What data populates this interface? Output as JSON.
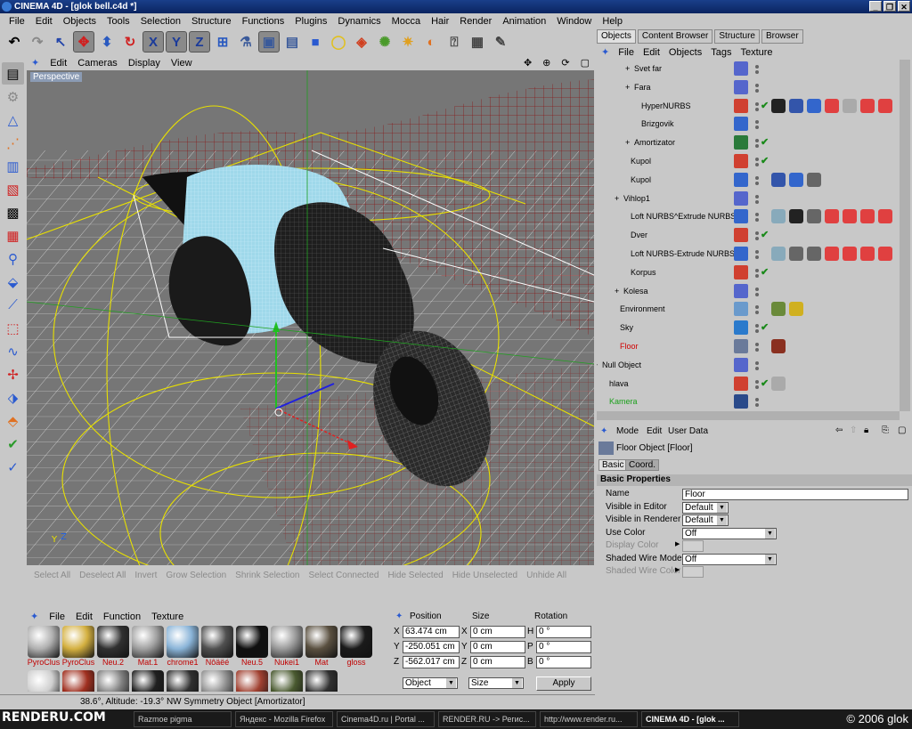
{
  "app": {
    "title": "CINEMA 4D - [glok bell.c4d *]"
  },
  "menu": [
    "File",
    "Edit",
    "Objects",
    "Tools",
    "Selection",
    "Structure",
    "Functions",
    "Plugins",
    "Dynamics",
    "Mocca",
    "Hair",
    "Render",
    "Animation",
    "Window",
    "Help"
  ],
  "toolbar_icons": [
    "undo-icon",
    "redo-icon",
    "select-arrow-icon",
    "move-icon",
    "scale-icon",
    "rotate-icon",
    "x-axis-icon",
    "y-axis-icon",
    "z-axis-icon",
    "coord-system-icon",
    "model-mode-icon",
    "object-mode-icon",
    "texture-mode-icon",
    "cube-icon",
    "spline-icon",
    "nurbs-icon",
    "deformer-icon",
    "light-icon",
    "scene-icon",
    "render-view-icon",
    "render-settings-icon",
    "render-picture-icon"
  ],
  "viewport": {
    "menu": [
      "Edit",
      "Cameras",
      "Display",
      "View"
    ],
    "label": "Perspective"
  },
  "selection_bar": [
    "Select All",
    "Deselect All",
    "Invert",
    "Grow Selection",
    "Shrink Selection",
    "Select Connected",
    "Hide Selected",
    "Hide Unselected",
    "Unhide All"
  ],
  "materials": {
    "menu": [
      "File",
      "Edit",
      "Function",
      "Texture"
    ],
    "row1": [
      {
        "name": "PyroClus",
        "color": "#b0b0b0"
      },
      {
        "name": "PyroClus",
        "color": "#d4b040"
      },
      {
        "name": "Neu.2",
        "color": "#303030"
      },
      {
        "name": "Mat.1",
        "color": "#a0a0a0"
      },
      {
        "name": "chrome1",
        "color": "#8ab4d8"
      },
      {
        "name": "Nôäëé",
        "color": "#505050"
      },
      {
        "name": "Neu.5",
        "color": "#101010"
      },
      {
        "name": "Nukei1",
        "color": "#9a9a9a"
      },
      {
        "name": "Mat",
        "color": "#5a5040"
      },
      {
        "name": "gloss",
        "color": "#1a1a1a"
      }
    ],
    "row2_colors": [
      "#cfcfcf",
      "#a03020",
      "#808080",
      "#202020",
      "#303030",
      "#909090",
      "#a04030",
      "#4a5a30",
      "#303030"
    ]
  },
  "coords": {
    "headers": {
      "position": "Position",
      "size": "Size",
      "rotation": "Rotation"
    },
    "rows": [
      {
        "axis": "X",
        "pos": "63.474 cm",
        "size_axis": "X",
        "size": "0 cm",
        "rot_axis": "H",
        "rot": "0 °"
      },
      {
        "axis": "Y",
        "pos": "-250.051 cm",
        "size_axis": "Y",
        "size": "0 cm",
        "rot_axis": "P",
        "rot": "0 °"
      },
      {
        "axis": "Z",
        "pos": "-562.017 cm",
        "size_axis": "Z",
        "size": "0 cm",
        "rot_axis": "B",
        "rot": "0 °"
      }
    ],
    "mode": "Object",
    "size_mode": "Size",
    "apply": "Apply"
  },
  "status": {
    "text": "38.6°, Altitude: -19.3°  NW   Symmetry Object [Amortizator]"
  },
  "taskbar": {
    "items": [
      "Razmoe pigma",
      "Яндекс - Mozilla Firefox",
      "Cinema4D.ru | Portal ...",
      "RENDER.RU -> Регис...",
      "http://www.render.ru...",
      "CINEMA 4D - [glok ..."
    ],
    "logo": "RENDERU.COM",
    "copyright": "© 2006 glok"
  },
  "objects": {
    "tabs": [
      "Objects",
      "Content Browser",
      "Structure",
      "Browser"
    ],
    "menu": [
      "File",
      "Edit",
      "Objects",
      "Tags",
      "Texture"
    ],
    "rows": [
      {
        "name": "Svet far",
        "indent": 40,
        "expander": "+",
        "icon": "#5566cc",
        "check": false,
        "color": "#000"
      },
      {
        "name": "Fara",
        "indent": 40,
        "expander": "+",
        "icon": "#5566cc",
        "check": false,
        "color": "#000"
      },
      {
        "name": "HyperNURBS",
        "indent": 48,
        "expander": "",
        "icon": "#d04030",
        "check": true,
        "color": "#000"
      },
      {
        "name": "Brizgovik",
        "indent": 48,
        "expander": "",
        "icon": "#3366cc",
        "check": false,
        "color": "#000"
      },
      {
        "name": "Amortizator",
        "indent": 40,
        "expander": "+",
        "icon": "#2a7a3a",
        "check": true,
        "color": "#000"
      },
      {
        "name": "Kupol",
        "indent": 36,
        "expander": "",
        "icon": "#d04030",
        "check": true,
        "color": "#000"
      },
      {
        "name": "Kupol",
        "indent": 36,
        "expander": "",
        "icon": "#3366cc",
        "check": false,
        "color": "#000"
      },
      {
        "name": "Vihlop1",
        "indent": 28,
        "expander": "+",
        "icon": "#5566cc",
        "check": false,
        "color": "#000"
      },
      {
        "name": "Loft NURBS^Extrude NURBS",
        "indent": 36,
        "expander": "",
        "icon": "#3366cc",
        "check": false,
        "color": "#000"
      },
      {
        "name": "Dver",
        "indent": 36,
        "expander": "",
        "icon": "#d04030",
        "check": true,
        "color": "#000"
      },
      {
        "name": "Loft NURBS-Extrude NURBS",
        "indent": 36,
        "expander": "",
        "icon": "#3366cc",
        "check": false,
        "color": "#000"
      },
      {
        "name": "Korpus",
        "indent": 36,
        "expander": "",
        "icon": "#d04030",
        "check": true,
        "color": "#000"
      },
      {
        "name": "Kolesa",
        "indent": 28,
        "expander": "+",
        "icon": "#5566cc",
        "check": false,
        "color": "#000"
      },
      {
        "name": "Environment",
        "indent": 24,
        "expander": "",
        "icon": "#6a9acc",
        "check": false,
        "color": "#000"
      },
      {
        "name": "Sky",
        "indent": 24,
        "expander": "",
        "icon": "#2a7acc",
        "check": true,
        "color": "#000"
      },
      {
        "name": "Floor",
        "indent": 24,
        "expander": "",
        "icon": "#6a7a9a",
        "check": false,
        "color": "#d00000"
      },
      {
        "name": "Null Object",
        "indent": 4,
        "expander": "+",
        "icon": "#5566cc",
        "check": false,
        "color": "#000"
      },
      {
        "name": "hlava",
        "indent": 12,
        "expander": "",
        "icon": "#d04030",
        "check": true,
        "color": "#000"
      },
      {
        "name": "Kamera",
        "indent": 12,
        "expander": "",
        "icon": "#2a4a8a",
        "check": false,
        "color": "#1aa01a"
      }
    ]
  },
  "attributes": {
    "menu": [
      "Mode",
      "Edit",
      "User Data"
    ],
    "object_title": "Floor Object [Floor]",
    "tabs": [
      "Basic",
      "Coord."
    ],
    "section": "Basic Properties",
    "fields": [
      {
        "label": "Name",
        "value": "Floor",
        "type": "text",
        "enabled": true
      },
      {
        "label": "Visible in Editor",
        "value": "Default",
        "type": "select",
        "enabled": true
      },
      {
        "label": "Visible in Renderer",
        "value": "Default",
        "type": "select",
        "enabled": true
      },
      {
        "label": "Use Color",
        "value": "Off",
        "type": "select",
        "enabled": true
      },
      {
        "label": "Display Color",
        "value": "",
        "type": "color",
        "enabled": false
      },
      {
        "label": "Shaded Wire Mode",
        "value": "Off",
        "type": "select",
        "enabled": true
      },
      {
        "label": "Shaded Wire Color",
        "value": "",
        "type": "color",
        "enabled": false
      }
    ]
  }
}
